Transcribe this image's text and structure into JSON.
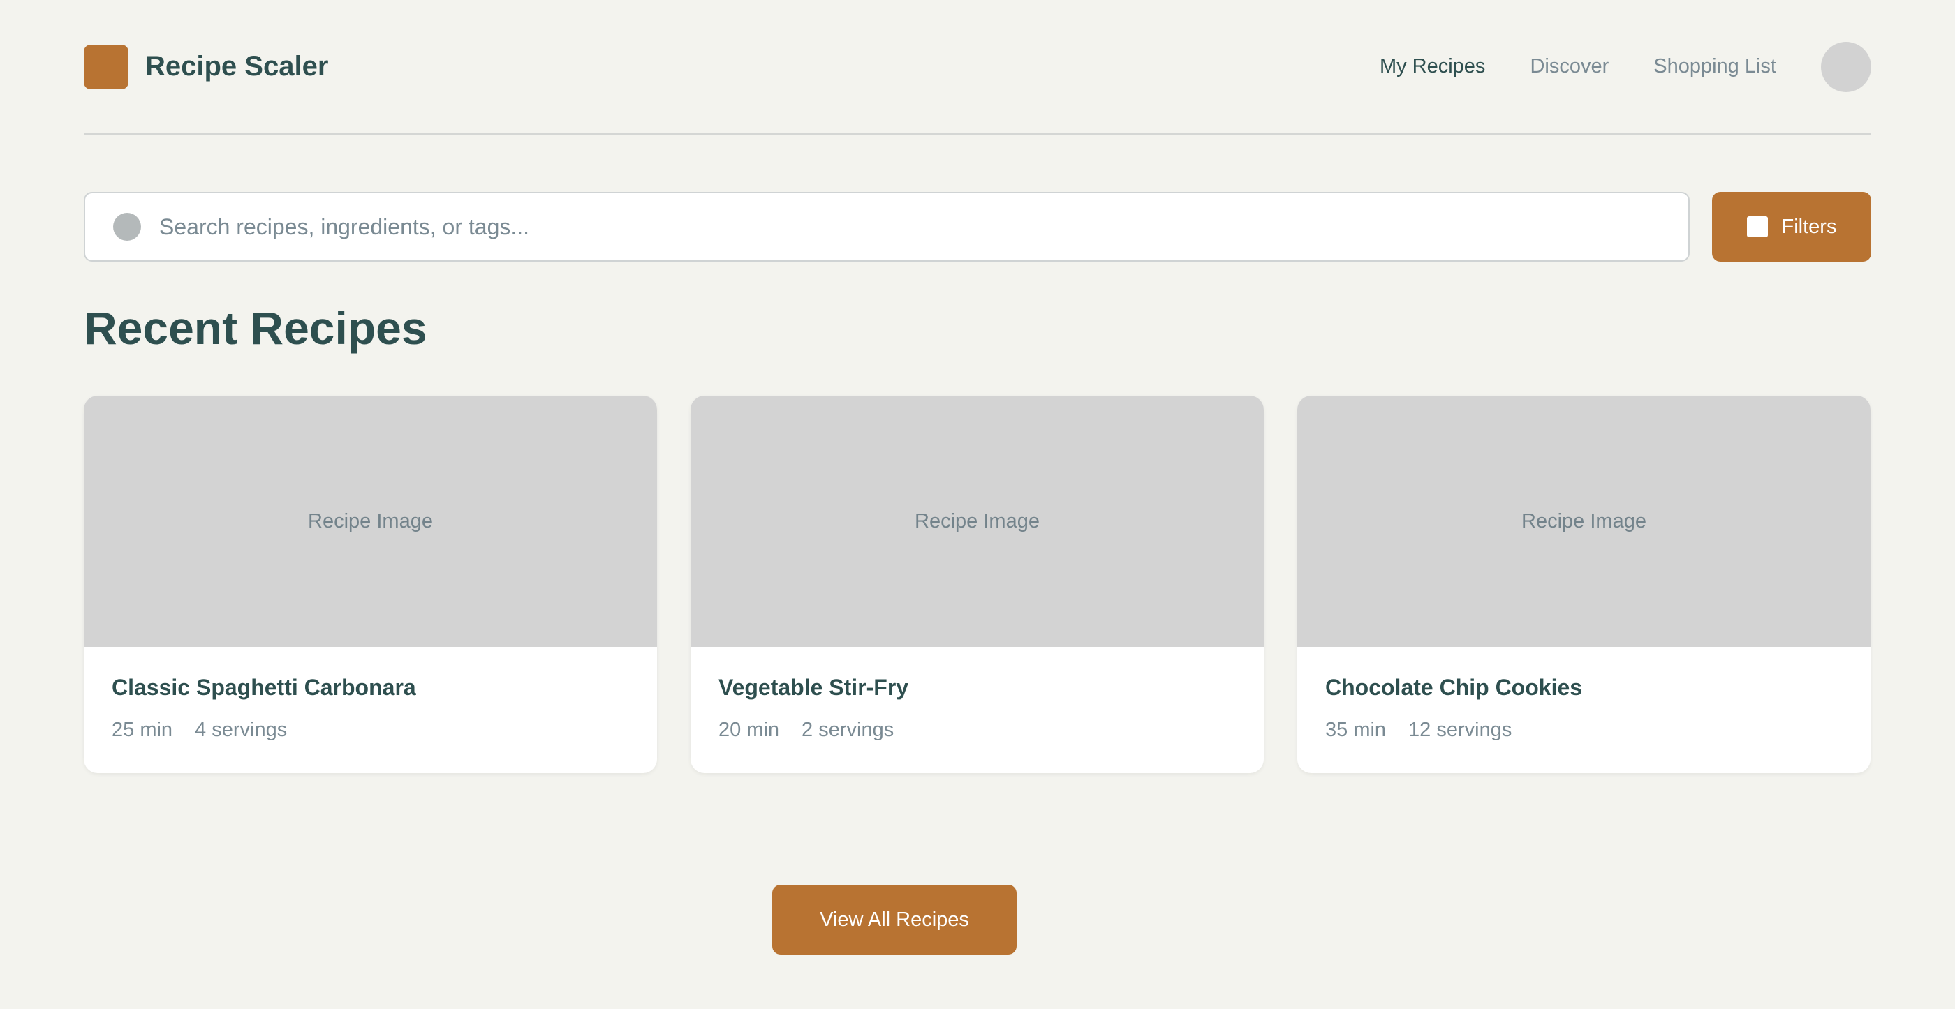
{
  "header": {
    "app_name": "Recipe Scaler",
    "nav": [
      {
        "label": "My Recipes",
        "active": true
      },
      {
        "label": "Discover",
        "active": false
      },
      {
        "label": "Shopping List",
        "active": false
      }
    ]
  },
  "search": {
    "placeholder": "Search recipes, ingredients, or tags...",
    "value": "",
    "filters_label": "Filters"
  },
  "section": {
    "title": "Recent Recipes"
  },
  "recipes": [
    {
      "image_label": "Recipe Image",
      "title": "Classic Spaghetti Carbonara",
      "time": "25 min",
      "servings": "4 servings"
    },
    {
      "image_label": "Recipe Image",
      "title": "Vegetable Stir-Fry",
      "time": "20 min",
      "servings": "2 servings"
    },
    {
      "image_label": "Recipe Image",
      "title": "Chocolate Chip Cookies",
      "time": "35 min",
      "servings": "12 servings"
    }
  ],
  "footer": {
    "view_all_label": "View All Recipes"
  },
  "colors": {
    "accent": "#b87332",
    "text_primary": "#2e4f4f",
    "text_muted": "#7a8a93",
    "background": "#f3f3ee",
    "placeholder_image": "#d3d3d3"
  },
  "icons": {
    "logo": "app-logo-square",
    "search": "search-icon",
    "filter": "filter-icon",
    "avatar": "user-avatar"
  }
}
